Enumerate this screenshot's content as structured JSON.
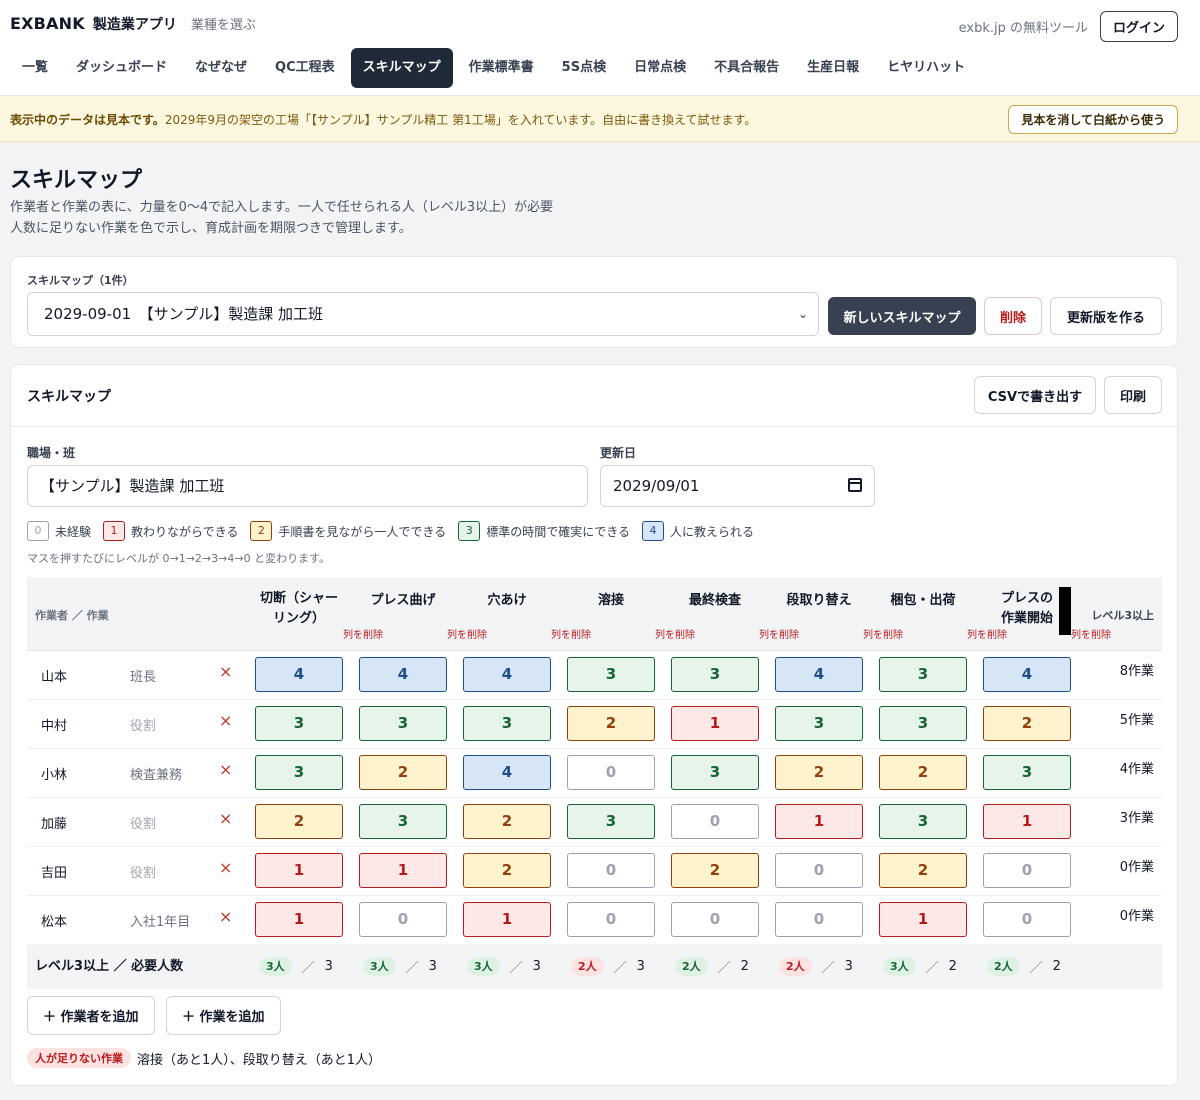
{
  "header": {
    "logo": "EXBANK",
    "app_name": "製造業アプリ",
    "pick_industry": "業種を選ぶ",
    "free_tool": "exbk.jp の無料ツール",
    "login": "ログイン"
  },
  "nav": [
    {
      "label": "一覧",
      "active": false
    },
    {
      "label": "ダッシュボード",
      "active": false
    },
    {
      "label": "なぜなぜ",
      "active": false
    },
    {
      "label": "QC工程表",
      "active": false
    },
    {
      "label": "スキルマップ",
      "active": true
    },
    {
      "label": "作業標準書",
      "active": false
    },
    {
      "label": "5S点検",
      "active": false
    },
    {
      "label": "日常点検",
      "active": false
    },
    {
      "label": "不具合報告",
      "active": false
    },
    {
      "label": "生産日報",
      "active": false
    },
    {
      "label": "ヒヤリハット",
      "active": false
    }
  ],
  "notice": {
    "bold": "表示中のデータは見本です。",
    "text": "2029年9月の架空の工場「【サンプル】サンプル精工 第1工場」を入れています。自由に書き換えて試せます。",
    "button": "見本を消して白紙から使う"
  },
  "page": {
    "title": "スキルマップ",
    "desc1": "作業者と作業の表に、力量を0〜4で記入します。一人で任せられる人（レベル3以上）が必要",
    "desc2": "人数に足りない作業を色で示し、育成計画を期限つきで管理します。"
  },
  "selector": {
    "label": "スキルマップ（1件）",
    "selected": "2029-09-01　【サンプル】製造課 加工班",
    "new_button": "新しいスキルマップ",
    "delete_button": "削除",
    "revision_button": "更新版を作る"
  },
  "map": {
    "title": "スキルマップ",
    "csv_button": "CSVで書き出す",
    "print_button": "印刷",
    "workplace_label": "職場・班",
    "workplace_value": "【サンプル】製造課 加工班",
    "date_label": "更新日",
    "date_value": "2029/09/01"
  },
  "legend": [
    {
      "level": "0",
      "label": "未経験"
    },
    {
      "level": "1",
      "label": "教わりながらできる"
    },
    {
      "level": "2",
      "label": "手順書を見ながら一人でできる"
    },
    {
      "level": "3",
      "label": "標準の時間で確実にできる"
    },
    {
      "level": "4",
      "label": "人に教えられる"
    }
  ],
  "hint": "マスを押すたびにレベルが 0→1→2→3→4→0 と変わります。",
  "table": {
    "worker_header": "作業者 ／ 作業",
    "level_header": "レベル3以上",
    "delete_col": "列を削除",
    "tasks": [
      "切断（シャーリング）",
      "プレス曲げ",
      "穴あけ",
      "溶接",
      "最終検査",
      "段取り替え",
      "梱包・出荷",
      "プレスの作業開始"
    ],
    "task_lines": [
      [
        "切断（シャー",
        "リング）"
      ],
      [
        "プレス曲げ"
      ],
      [
        "穴あけ"
      ],
      [
        "溶接"
      ],
      [
        "最終検査"
      ],
      [
        "段取り替え"
      ],
      [
        "梱包・出荷"
      ],
      [
        "プレスの",
        "作業開始"
      ]
    ],
    "workers": [
      {
        "name": "山本",
        "role": "班長",
        "role_placeholder": false,
        "levels": [
          4,
          4,
          4,
          3,
          3,
          4,
          3,
          4
        ],
        "count": "8作業"
      },
      {
        "name": "中村",
        "role": "役割",
        "role_placeholder": true,
        "levels": [
          3,
          3,
          3,
          2,
          1,
          3,
          3,
          2
        ],
        "count": "5作業"
      },
      {
        "name": "小林",
        "role": "検査兼務",
        "role_placeholder": false,
        "levels": [
          3,
          2,
          4,
          0,
          3,
          2,
          2,
          3
        ],
        "count": "4作業"
      },
      {
        "name": "加藤",
        "role": "役割",
        "role_placeholder": true,
        "levels": [
          2,
          3,
          2,
          3,
          0,
          1,
          3,
          1
        ],
        "count": "3作業"
      },
      {
        "name": "吉田",
        "role": "役割",
        "role_placeholder": true,
        "levels": [
          1,
          1,
          2,
          0,
          2,
          0,
          2,
          0
        ],
        "count": "0作業"
      },
      {
        "name": "松本",
        "role": "入社1年目",
        "role_placeholder": false,
        "levels": [
          1,
          0,
          1,
          0,
          0,
          0,
          1,
          0
        ],
        "count": "0作業"
      }
    ],
    "footer_label": "レベル3以上 ／ 必要人数",
    "totals": [
      {
        "have": "3人",
        "need": "3",
        "ok": true
      },
      {
        "have": "3人",
        "need": "3",
        "ok": true
      },
      {
        "have": "3人",
        "need": "3",
        "ok": true
      },
      {
        "have": "2人",
        "need": "3",
        "ok": false
      },
      {
        "have": "2人",
        "need": "2",
        "ok": true
      },
      {
        "have": "2人",
        "need": "3",
        "ok": false
      },
      {
        "have": "3人",
        "need": "2",
        "ok": true
      },
      {
        "have": "2人",
        "need": "2",
        "ok": true
      }
    ]
  },
  "actions": {
    "add_worker": "＋ 作業者を追加",
    "add_task": "＋ 作業を追加"
  },
  "shortage": {
    "tag": "人が足りない作業",
    "text": "溶接（あと1人）、段取り替え（あと1人）"
  }
}
